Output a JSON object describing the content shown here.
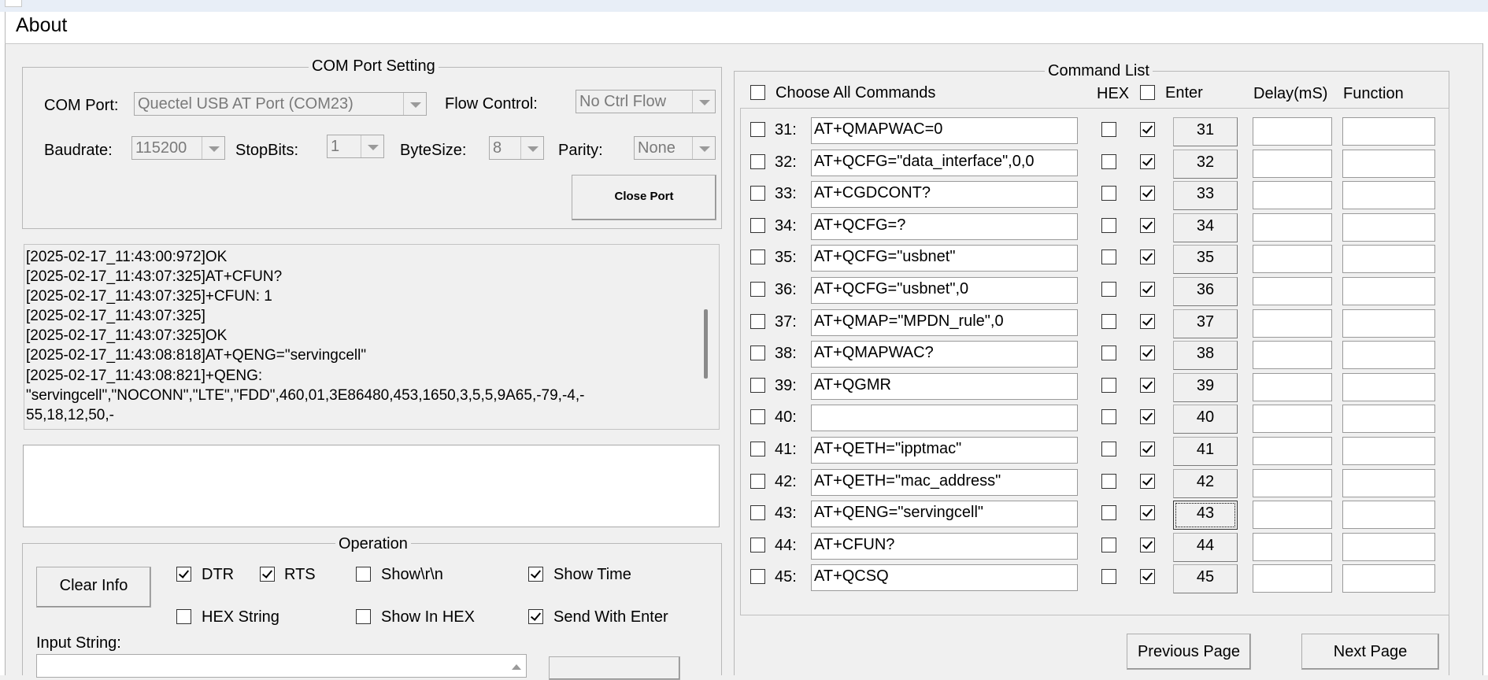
{
  "menu": {
    "about": "About"
  },
  "com_port_setting": {
    "title": "COM Port Setting",
    "com_port_label": "COM Port:",
    "com_port_value": "Quectel USB AT Port (COM23)",
    "flow_control_label": "Flow Control:",
    "flow_control_value": "No Ctrl Flow",
    "baudrate_label": "Baudrate:",
    "baudrate_value": "115200",
    "stopbits_label": "StopBits:",
    "stopbits_value": "1",
    "bytesize_label": "ByteSize:",
    "bytesize_value": "8",
    "parity_label": "Parity:",
    "parity_value": "None",
    "close_port_label": "Close Port"
  },
  "log": {
    "lines": [
      "[2025-02-17_11:43:00:972]OK",
      "[2025-02-17_11:43:07:325]AT+CFUN?",
      "[2025-02-17_11:43:07:325]+CFUN: 1",
      "[2025-02-17_11:43:07:325]",
      "[2025-02-17_11:43:07:325]OK",
      "[2025-02-17_11:43:08:818]AT+QENG=\"servingcell\"",
      "[2025-02-17_11:43:08:821]+QENG:",
      "\"servingcell\",\"NOCONN\",\"LTE\",\"FDD\",460,01,3E86480,453,1650,3,5,5,9A65,-79,-4,-",
      "55,18,12,50,-"
    ]
  },
  "operation": {
    "title": "Operation",
    "clear_info_label": "Clear Info",
    "dtr_label": "DTR",
    "dtr_checked": true,
    "rts_label": "RTS",
    "rts_checked": true,
    "show_rn_label": "Show\\r\\n",
    "show_rn_checked": false,
    "show_time_label": "Show Time",
    "show_time_checked": true,
    "hex_string_label": "HEX String",
    "hex_string_checked": false,
    "show_in_hex_label": "Show In HEX",
    "show_in_hex_checked": false,
    "send_with_enter_label": "Send With Enter",
    "send_with_enter_checked": true,
    "input_string_label": "Input String:"
  },
  "command_list": {
    "title": "Command List",
    "choose_all_label": "Choose All Commands",
    "hex_header": "HEX",
    "enter_header": "Enter",
    "delay_header": "Delay(mS)",
    "function_header": "Function",
    "previous_page_label": "Previous Page",
    "next_page_label": "Next Page",
    "rows": [
      {
        "num": "31:",
        "cmd": "AT+QMAPWAC=0",
        "btn": "31",
        "enter": true
      },
      {
        "num": "32:",
        "cmd": "AT+QCFG=\"data_interface\",0,0",
        "btn": "32",
        "enter": true
      },
      {
        "num": "33:",
        "cmd": "AT+CGDCONT?",
        "btn": "33",
        "enter": true
      },
      {
        "num": "34:",
        "cmd": "AT+QCFG=?",
        "btn": "34",
        "enter": true
      },
      {
        "num": "35:",
        "cmd": "AT+QCFG=\"usbnet\"",
        "btn": "35",
        "enter": true
      },
      {
        "num": "36:",
        "cmd": "AT+QCFG=\"usbnet\",0",
        "btn": "36",
        "enter": true
      },
      {
        "num": "37:",
        "cmd": "AT+QMAP=\"MPDN_rule\",0",
        "btn": "37",
        "enter": true
      },
      {
        "num": "38:",
        "cmd": "AT+QMAPWAC?",
        "btn": "38",
        "enter": true
      },
      {
        "num": "39:",
        "cmd": "AT+QGMR",
        "btn": "39",
        "enter": true
      },
      {
        "num": "40:",
        "cmd": "",
        "btn": "40",
        "enter": true
      },
      {
        "num": "41:",
        "cmd": "AT+QETH=\"ipptmac\"",
        "btn": "41",
        "enter": true
      },
      {
        "num": "42:",
        "cmd": "AT+QETH=\"mac_address\"",
        "btn": "42",
        "enter": true
      },
      {
        "num": "43:",
        "cmd": "AT+QENG=\"servingcell\"",
        "btn": "43",
        "enter": true
      },
      {
        "num": "44:",
        "cmd": "AT+CFUN?",
        "btn": "44",
        "enter": true
      },
      {
        "num": "45:",
        "cmd": "AT+QCSQ",
        "btn": "45",
        "enter": true
      }
    ]
  }
}
